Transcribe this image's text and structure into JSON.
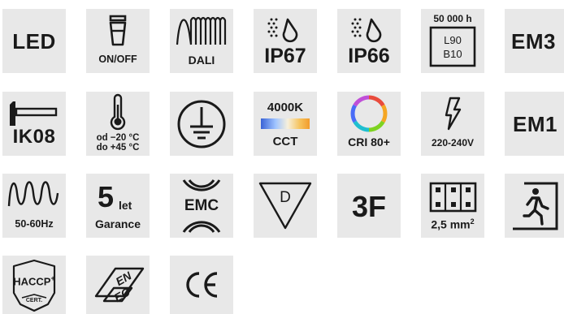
{
  "colors": {
    "tile_bg": "#e8e8e8",
    "ink": "#1a1a1a"
  },
  "icons": [
    {
      "id": "led",
      "icon": "led-label",
      "label": "LED"
    },
    {
      "id": "onoff",
      "icon": "switch-icon",
      "label": "ON/OFF"
    },
    {
      "id": "dali",
      "icon": "dali-wave-icon",
      "label": "DALI"
    },
    {
      "id": "ip67",
      "icon": "water-drop-icon",
      "label": "IP67"
    },
    {
      "id": "ip66",
      "icon": "water-drop-icon",
      "label": "IP66"
    },
    {
      "id": "lifetime",
      "icon": "lifetime-box-icon",
      "hours": "50 000 h",
      "l": "L90",
      "b": "B10"
    },
    {
      "id": "em3",
      "icon": "emergency-label",
      "label": "EM3"
    },
    {
      "id": "ik08",
      "icon": "impact-hammer-icon",
      "label": "IK08"
    },
    {
      "id": "temp",
      "icon": "thermometer-icon",
      "line1": "od −20 °C",
      "line2": "do +45 °C"
    },
    {
      "id": "ground",
      "icon": "protective-earth-icon"
    },
    {
      "id": "cct",
      "icon": "color-temperature-bar-icon",
      "top": "4000K",
      "label": "CCT"
    },
    {
      "id": "cri",
      "icon": "color-ring-icon",
      "label": "CRI 80+"
    },
    {
      "id": "voltage",
      "icon": "lightning-icon",
      "label": "220-240V"
    },
    {
      "id": "em1",
      "icon": "emergency-label",
      "label": "EM1"
    },
    {
      "id": "freq",
      "icon": "sine-wave-icon",
      "label": "50-60Hz"
    },
    {
      "id": "warranty",
      "icon": "warranty-label",
      "num": "5",
      "suffix": "let",
      "label": "Garance"
    },
    {
      "id": "emc",
      "icon": "emc-waves-icon",
      "label": "EMC"
    },
    {
      "id": "d-mark",
      "icon": "d-triangle-icon",
      "label": "D"
    },
    {
      "id": "3f",
      "icon": "three-f-label",
      "label": "3F"
    },
    {
      "id": "terminal",
      "icon": "terminal-block-icon",
      "label": "2,5 mm",
      "sup": "2"
    },
    {
      "id": "exit",
      "icon": "emergency-exit-icon"
    },
    {
      "id": "haccp",
      "icon": "haccp-shield-icon",
      "label": "HACCP",
      "plus": "+",
      "sub": "CERT."
    },
    {
      "id": "enec",
      "icon": "enec-mark-icon",
      "label": "ENEC"
    },
    {
      "id": "ce",
      "icon": "ce-mark-icon",
      "label": "CE"
    }
  ]
}
